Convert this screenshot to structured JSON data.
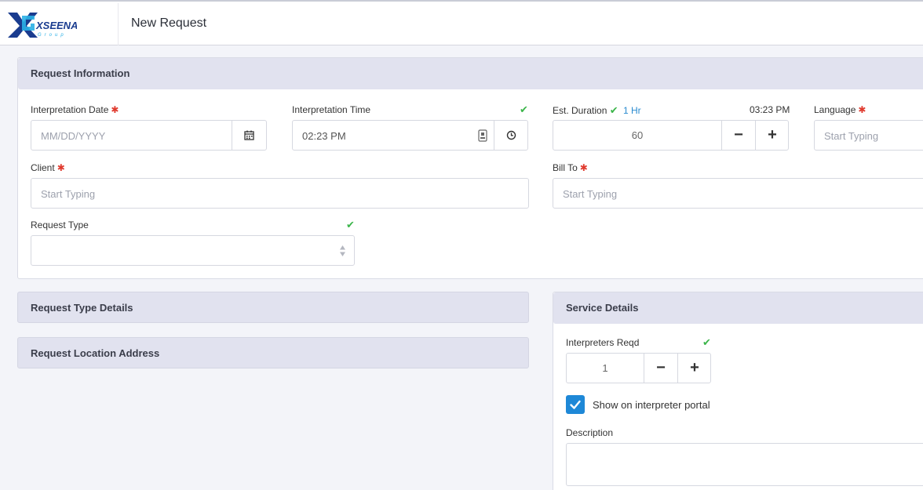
{
  "app": {
    "brand": "XSEENA",
    "brand_sub": "Group",
    "page_title": "New Request"
  },
  "colors": {
    "accent": "#1e88d7",
    "required": "#e03a2e",
    "success": "#3bb54a",
    "header_bg": "#e1e2ef"
  },
  "request_info": {
    "title": "Request Information",
    "interpretation_date": {
      "label": "Interpretation Date",
      "required_mark": "✱",
      "placeholder": "MM/DD/YYYY",
      "icon": "calendar-icon"
    },
    "interpretation_time": {
      "label": "Interpretation Time",
      "check": "✔",
      "value": "02:23 PM",
      "icons": [
        "keypad-icon",
        "clock-icon"
      ]
    },
    "est_duration": {
      "label": "Est. Duration",
      "check": "✔",
      "hint": "1 Hr",
      "end_time": "03:23 PM",
      "value": "60",
      "minus": "−",
      "plus": "+"
    },
    "language": {
      "label": "Language",
      "required_mark": "✱",
      "placeholder": "Start Typing"
    },
    "client": {
      "label": "Client",
      "required_mark": "✱",
      "placeholder": "Start Typing"
    },
    "bill_to": {
      "label": "Bill To",
      "required_mark": "✱",
      "placeholder": "Start Typing"
    },
    "request_type": {
      "label": "Request Type",
      "check": "✔",
      "value": ""
    }
  },
  "request_type_details": {
    "title": "Request Type Details"
  },
  "request_location": {
    "title": "Request Location Address"
  },
  "service_details": {
    "title": "Service Details",
    "interpreters": {
      "label": "Interpreters Reqd",
      "check": "✔",
      "value": "1",
      "minus": "−",
      "plus": "+"
    },
    "show_on_portal": {
      "label": "Show on interpreter portal",
      "checked": true
    },
    "description": {
      "label": "Description",
      "value": ""
    }
  }
}
